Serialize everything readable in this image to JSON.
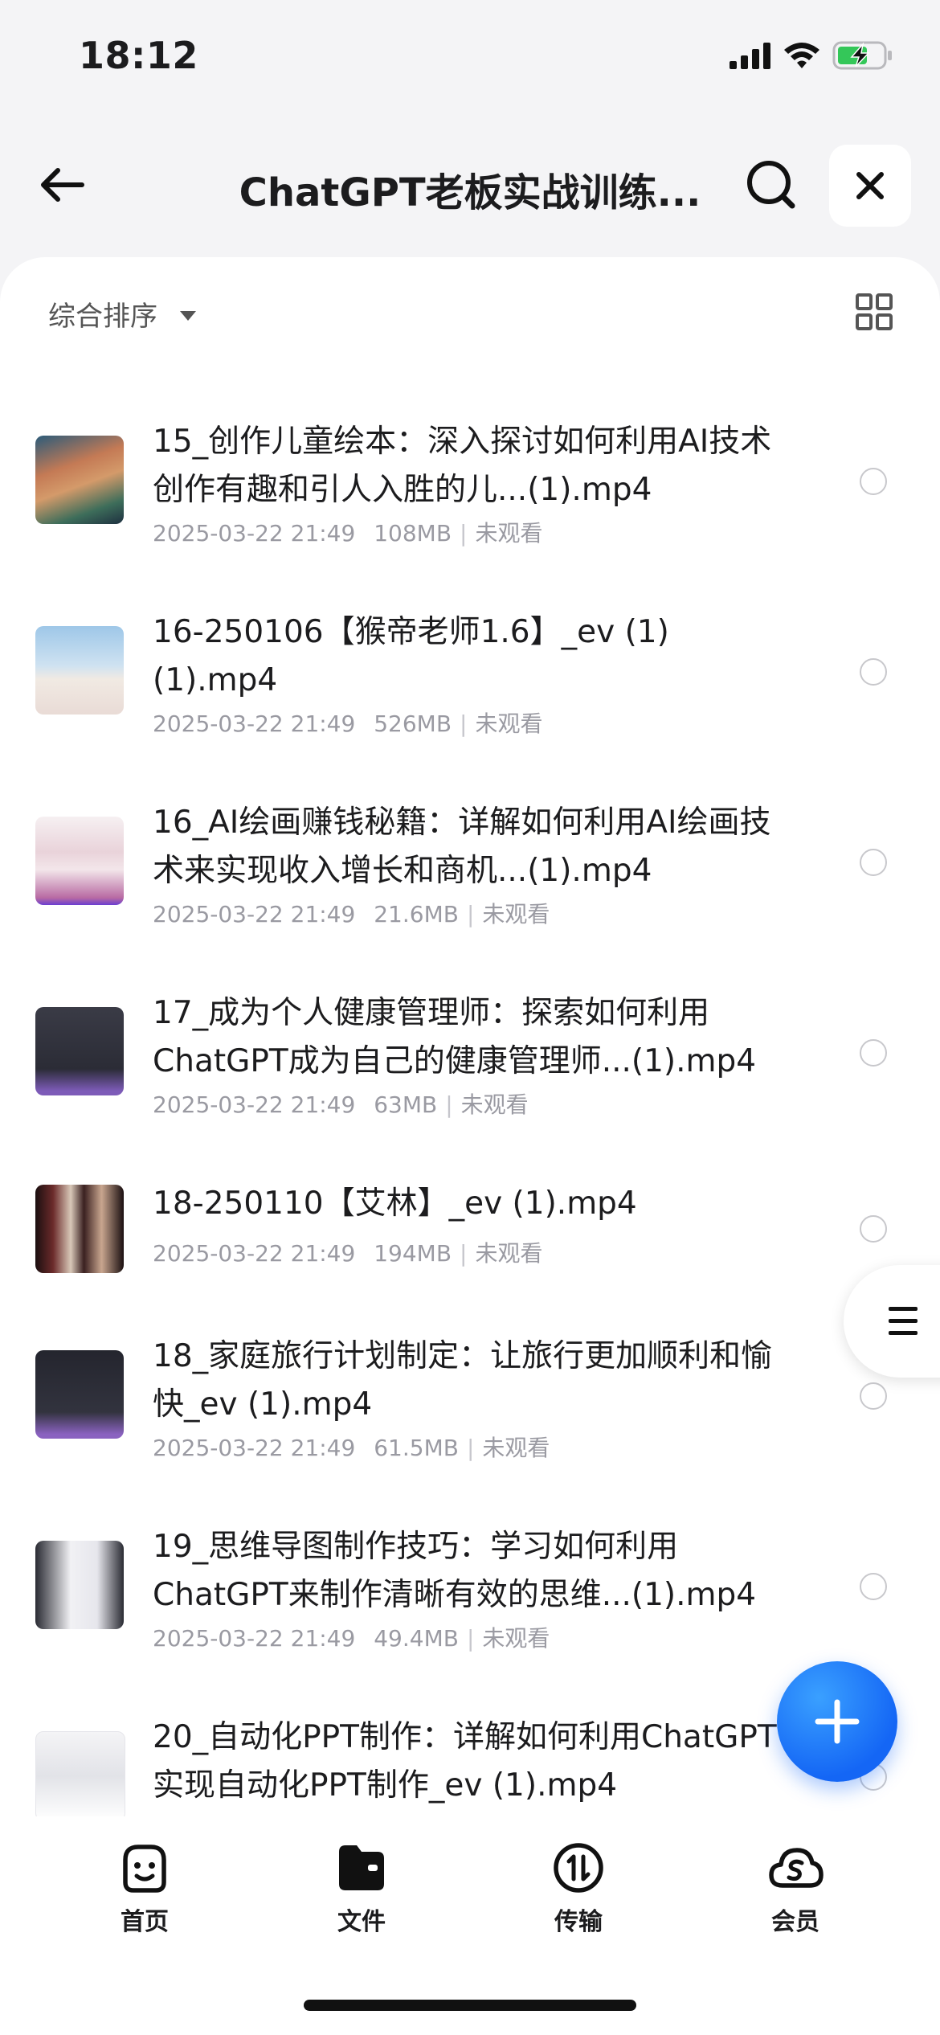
{
  "status": {
    "time": "18:12"
  },
  "header": {
    "title": "ChatGPT老板实战训练..."
  },
  "toolbar": {
    "sort_label": "综合排序"
  },
  "files": [
    {
      "name": "15_创作儿童绘本：深入探讨如何利用AI技术创作有趣和引人入胜的儿...(1).mp4",
      "date": "2025-03-22 21:49",
      "size": "108MB",
      "status": "未观看"
    },
    {
      "name": "16-250106【猴帝老师1.6】_ev (1) (1).mp4",
      "date": "2025-03-22 21:49",
      "size": "526MB",
      "status": "未观看"
    },
    {
      "name": "16_AI绘画赚钱秘籍：详解如何利用AI绘画技术来实现收入增长和商机...(1).mp4",
      "date": "2025-03-22 21:49",
      "size": "21.6MB",
      "status": "未观看"
    },
    {
      "name": "17_成为个人健康管理师：探索如何利用ChatGPT成为自己的健康管理师...(1).mp4",
      "date": "2025-03-22 21:49",
      "size": "63MB",
      "status": "未观看"
    },
    {
      "name": "18-250110【艾林】_ev (1).mp4",
      "date": "2025-03-22 21:49",
      "size": "194MB",
      "status": "未观看"
    },
    {
      "name": "18_家庭旅行计划制定：让旅行更加顺利和愉快_ev (1).mp4",
      "date": "2025-03-22 21:49",
      "size": "61.5MB",
      "status": "未观看"
    },
    {
      "name": "19_思维导图制作技巧：学习如何利用ChatGPT来制作清晰有效的思维...(1).mp4",
      "date": "2025-03-22 21:49",
      "size": "49.4MB",
      "status": "未观看"
    },
    {
      "name": "20_自动化PPT制作：详解如何利用ChatGPT实现自动化PPT制作_ev (1).mp4",
      "date": "",
      "size": "",
      "status": ""
    }
  ],
  "tabs": [
    {
      "label": "首页",
      "icon": "smile-face-icon"
    },
    {
      "label": "文件",
      "icon": "folder-icon"
    },
    {
      "label": "传输",
      "icon": "transfer-icon"
    },
    {
      "label": "会员",
      "icon": "cloud-s-icon"
    }
  ],
  "colors": {
    "accent": "#1466f5",
    "text": "#1c1c1e",
    "meta": "#9a9aa2",
    "battery": "#34c759"
  }
}
